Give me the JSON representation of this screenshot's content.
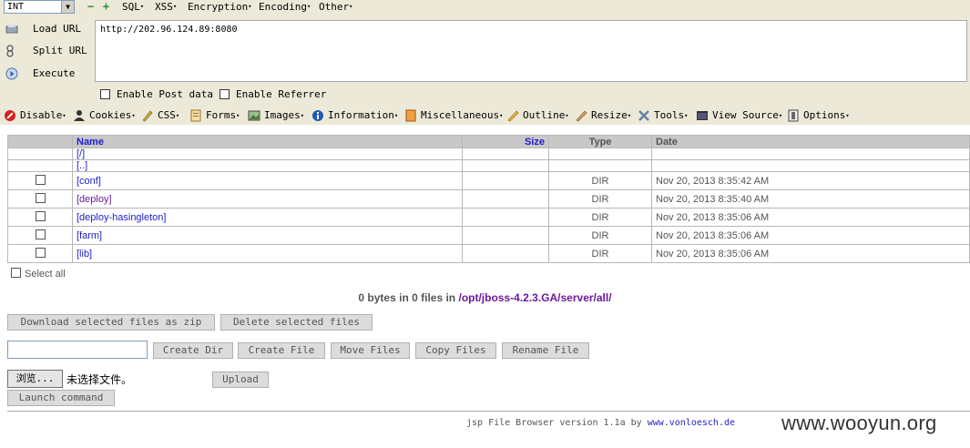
{
  "hackbar": {
    "select_value": "INT",
    "menus": [
      "SQL",
      "XSS",
      "Encryption",
      "Encoding",
      "Other"
    ],
    "side_buttons": [
      {
        "label": "Load URL",
        "icon": "load-url-icon"
      },
      {
        "label": "Split URL",
        "icon": "split-url-icon"
      },
      {
        "label": "Execute",
        "icon": "execute-icon"
      }
    ],
    "url": "http://202.96.124.89:8080",
    "checkboxes": [
      "Enable Post data",
      "Enable Referrer"
    ]
  },
  "webdev": {
    "items": [
      {
        "label": "Disable",
        "icon": "disable-icon",
        "color": "#d42020"
      },
      {
        "label": "Cookies",
        "icon": "cookies-icon",
        "color": "#333333"
      },
      {
        "label": "CSS",
        "icon": "css-icon",
        "color": "#d8b020"
      },
      {
        "label": "Forms",
        "icon": "forms-icon",
        "color": "#c09040"
      },
      {
        "label": "Images",
        "icon": "images-icon",
        "color": "#4a7a3a"
      },
      {
        "label": "Information",
        "icon": "information-icon",
        "color": "#1e5ab4"
      },
      {
        "label": "Miscellaneous",
        "icon": "miscellaneous-icon",
        "color": "#e08a20"
      },
      {
        "label": "Outline",
        "icon": "outline-icon",
        "color": "#c0a030"
      },
      {
        "label": "Resize",
        "icon": "resize-icon",
        "color": "#c89040"
      },
      {
        "label": "Tools",
        "icon": "tools-icon",
        "color": "#6080a0"
      },
      {
        "label": "View Source",
        "icon": "view-source-icon",
        "color": "#333333"
      },
      {
        "label": "Options",
        "icon": "options-icon",
        "color": "#666666"
      }
    ]
  },
  "table": {
    "headers": {
      "name": "Name",
      "size": "Size",
      "type": "Type",
      "date": "Date"
    },
    "nav_rows": [
      {
        "name": "[/]"
      },
      {
        "name": "[..]"
      }
    ],
    "rows": [
      {
        "name": "[conf]",
        "size": "",
        "type": "DIR",
        "date": "Nov 20, 2013 8:35:42 AM"
      },
      {
        "name": "[deploy]",
        "size": "",
        "type": "DIR",
        "date": "Nov 20, 2013 8:35:40 AM"
      },
      {
        "name": "[deploy-hasingleton]",
        "size": "",
        "type": "DIR",
        "date": "Nov 20, 2013 8:35:06 AM"
      },
      {
        "name": "[farm]",
        "size": "",
        "type": "DIR",
        "date": "Nov 20, 2013 8:35:06 AM"
      },
      {
        "name": "[lib]",
        "size": "",
        "type": "DIR",
        "date": "Nov 20, 2013 8:35:06 AM"
      }
    ]
  },
  "select_all": "Select all",
  "summary": {
    "prefix": "0 bytes in 0 files in",
    "path": "/opt/jboss-4.2.3.GA/server/all/"
  },
  "buttons": {
    "download": "Download selected files as zip",
    "delete": "Delete selected files",
    "create_dir": "Create Dir",
    "create_file": "Create File",
    "move_files": "Move Files",
    "copy_files": "Copy Files",
    "rename_file": "Rename File",
    "browse": "浏览...",
    "no_file": "未选择文件。",
    "upload": "Upload",
    "launch": "Launch command"
  },
  "footer": {
    "text": "jsp File Browser version 1.1a by",
    "link": "www.vonloesch.de"
  },
  "watermark": "www.wooyun.org"
}
